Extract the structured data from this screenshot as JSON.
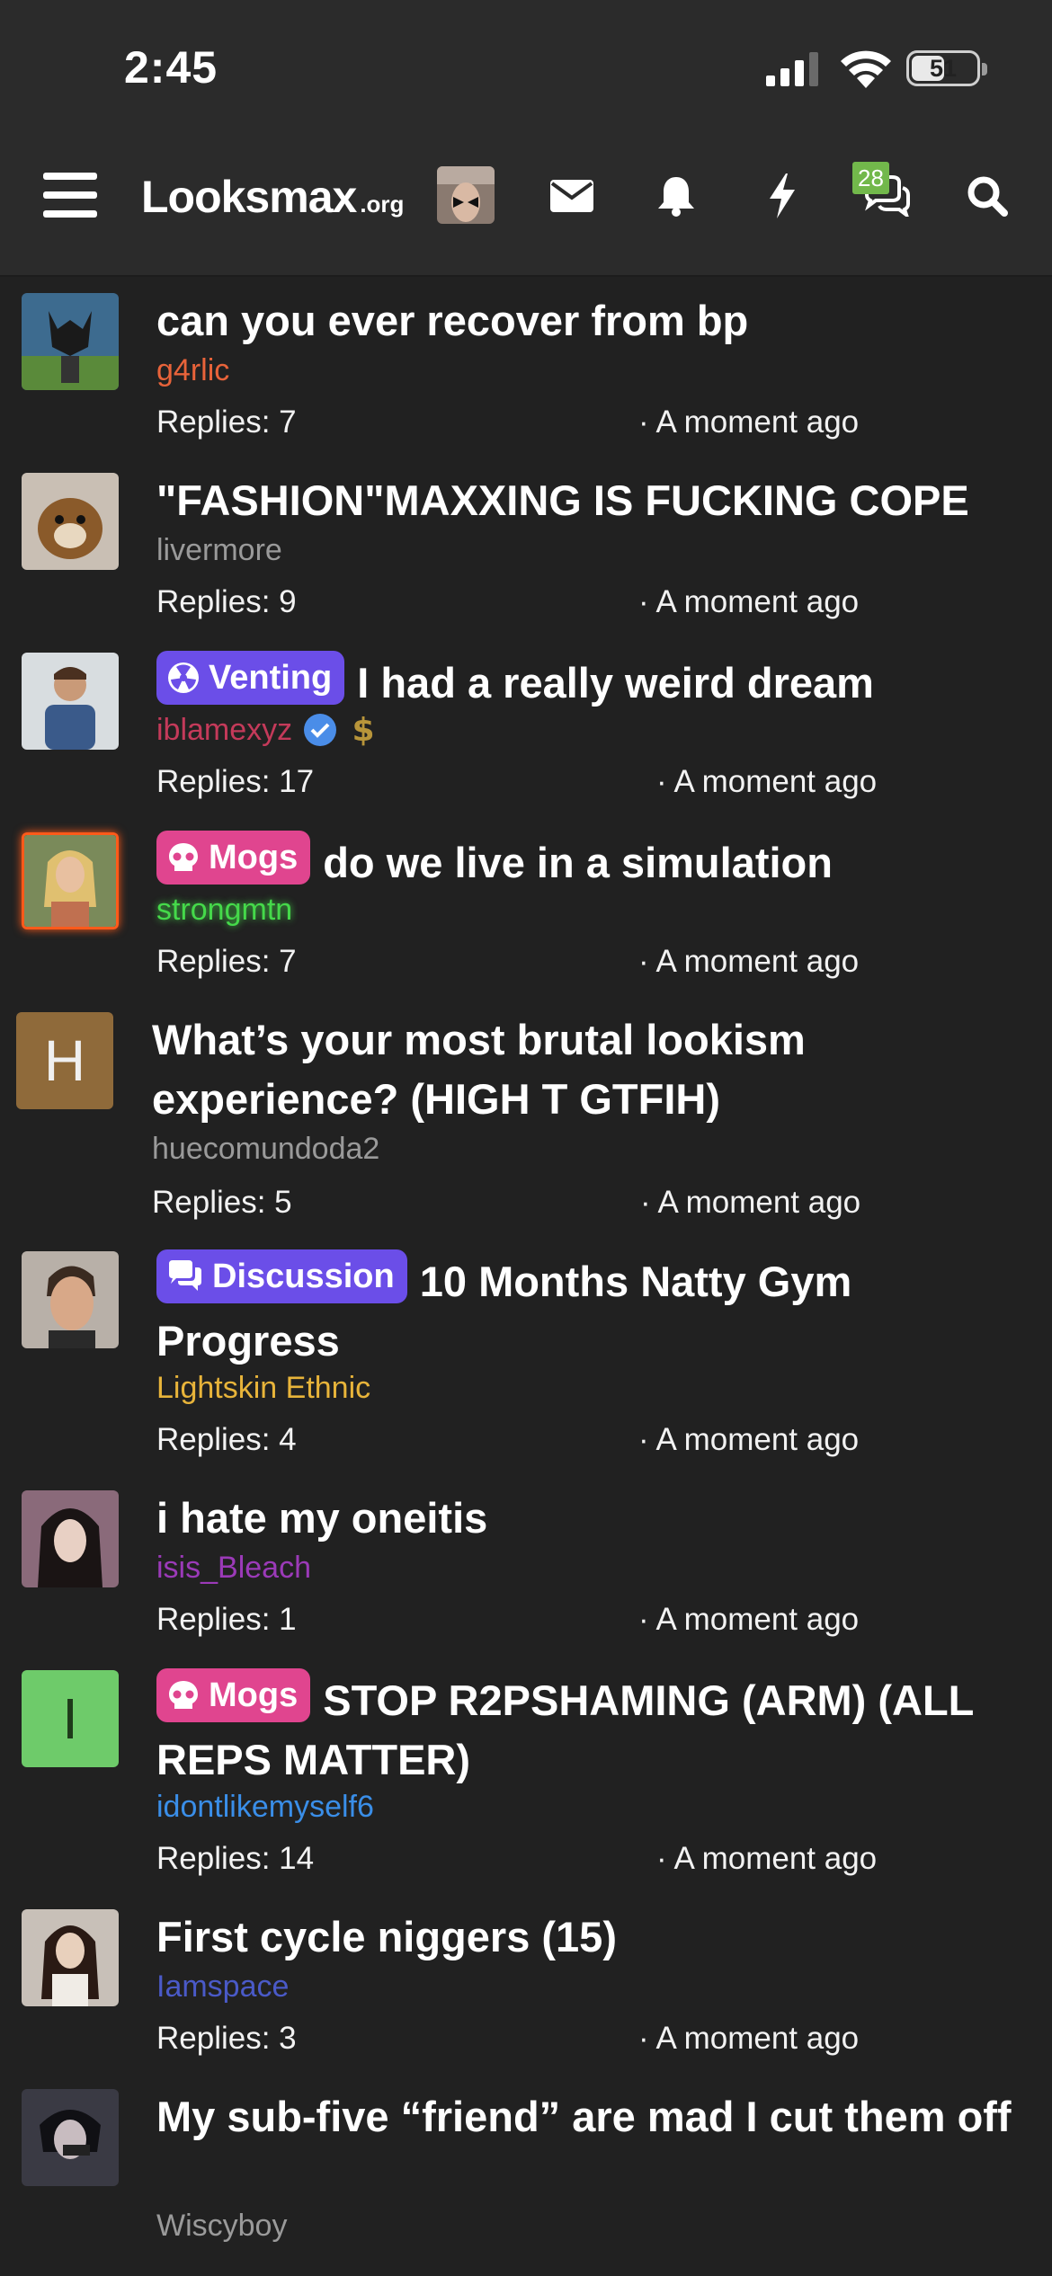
{
  "status_bar": {
    "time": "2:45",
    "battery": "51",
    "battery_level": 0.51
  },
  "header": {
    "logo_main": "Looksmax",
    "logo_tld": ".org",
    "conversations_badge": "28",
    "icons": [
      "menu-icon",
      "envelope-icon",
      "bell-icon",
      "lightning-icon",
      "comments-icon",
      "search-icon"
    ]
  },
  "colors": {
    "background": "#212121",
    "header": "#2b2b2b",
    "venting_prefix": "#6b4ee8",
    "mogs_prefix": "#e0458f",
    "discussion_prefix": "#6b4ee8",
    "badge": "#72b84b"
  },
  "threads": [
    {
      "title": "can you ever recover from bp",
      "prefix": "",
      "author": "g4rlic",
      "author_color": "#e8633a",
      "replies": "Replies: 7",
      "time": "· A moment ago"
    },
    {
      "title": "\"FASHION\"MAXXING IS FUCKING COPE",
      "prefix": "",
      "author": "livermore",
      "author_color": "#9a9a9a",
      "replies": "Replies: 9",
      "time": "· A moment ago"
    },
    {
      "title": "I had a really weird dream",
      "prefix": "Venting",
      "author": "iblamexyz",
      "author_color": "#c43a5a",
      "replies": "Replies: 17",
      "time": "· A moment ago"
    },
    {
      "title": "do we live in a simulation",
      "prefix": "Mogs",
      "author": "strongmtn",
      "author_color": "#45d94a",
      "replies": "Replies: 7",
      "time": "· A moment ago"
    },
    {
      "title": "What’s your most brutal lookism experience? (HIGH T GTFIH)",
      "prefix": "",
      "author": "huecomundoda2",
      "author_color": "#9a9a9a",
      "avatar_letter": "H",
      "replies": "Replies: 5",
      "time": "· A moment ago"
    },
    {
      "title": "10 Months Natty Gym Progress",
      "prefix": "Discussion",
      "author": "Lightskin Ethnic",
      "author_color": "#e8b43a",
      "replies": "Replies: 4",
      "time": "· A moment ago"
    },
    {
      "title": "i hate my oneitis",
      "prefix": "",
      "author": "isis_Bleach",
      "author_color": "#9b3ab8",
      "replies": "Replies: 1",
      "time": "· A moment ago"
    },
    {
      "title": "STOP R2PSHAMING (ARM) (ALL REPS MATTER)",
      "prefix": "Mogs",
      "author": "idontlikemyself6",
      "author_color": "#3a8ee8",
      "avatar_letter": "I",
      "replies": "Replies: 14",
      "time": "· A moment ago"
    },
    {
      "title": "First cycle niggers (15)",
      "prefix": "",
      "author": "Iamspace",
      "author_color": "#4a5ac8",
      "replies": "Replies: 3",
      "time": "· A moment ago"
    },
    {
      "title": "My sub-five “friend” are mad I cut them off",
      "prefix": "",
      "author": "Wiscyboy",
      "author_color": "#9a9a9a",
      "replies": "",
      "time": ""
    }
  ]
}
